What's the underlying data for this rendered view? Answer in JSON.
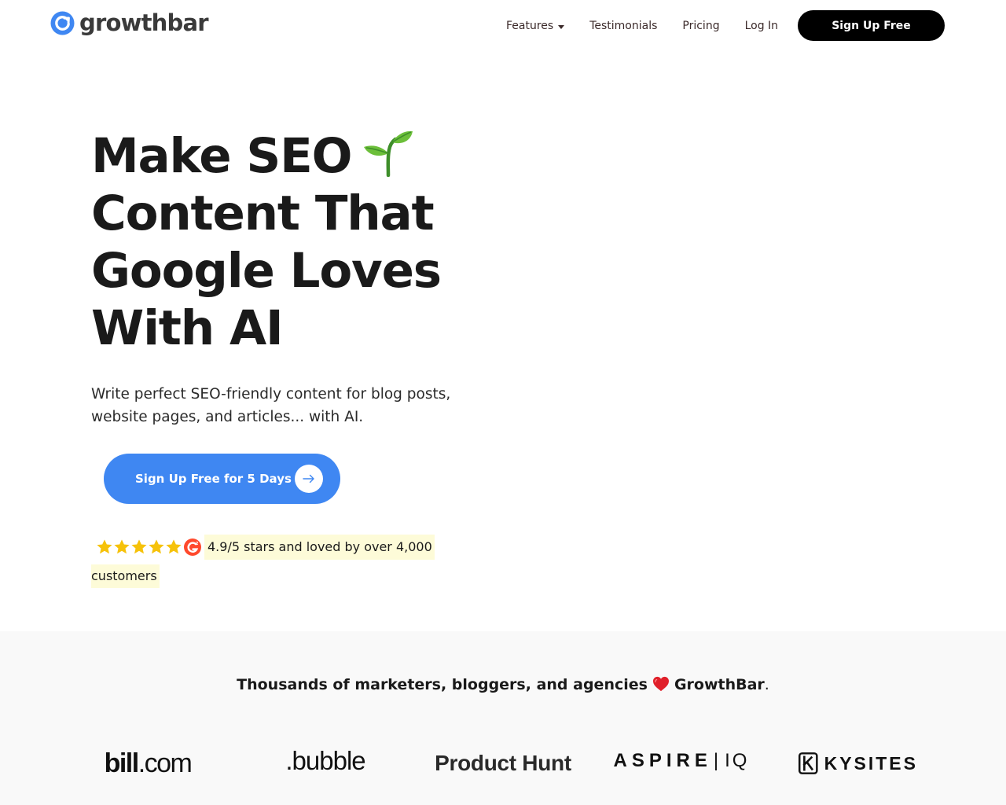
{
  "header": {
    "logo_text": "growthbar",
    "nav": {
      "features": "Features",
      "testimonials": "Testimonials",
      "pricing": "Pricing",
      "login": "Log In"
    },
    "signup_label": "Sign Up Free"
  },
  "hero": {
    "title_lines": [
      "Make SEO",
      "Content That",
      "Google Loves",
      "With AI"
    ],
    "subtitle": "Write perfect SEO-friendly content for blog posts, website pages, and articles... with AI.",
    "cta_label": "Sign Up Free for 5 Days",
    "rating": {
      "stars": 5,
      "text_line1": "4.9/5 stars and loved by over 4,000",
      "text_line2": "customers"
    }
  },
  "social_proof": {
    "title_before": "Thousands of marketers, bloggers, and agencies",
    "title_brand": "GrowthBar",
    "title_after": ".",
    "logos": {
      "bill": "bill",
      "bill_suffix": ".com",
      "bubble": ".bubble",
      "producthunt": "Product Hunt",
      "aspire": "ASPIRE",
      "aspire_sep": "|",
      "aspire_suffix": "IQ",
      "kysites": "KYSITES"
    }
  },
  "colors": {
    "accent": "#3f87f2",
    "highlight": "#fdfbd8",
    "star": "#f6c20a",
    "band": "#f9f9f9"
  }
}
